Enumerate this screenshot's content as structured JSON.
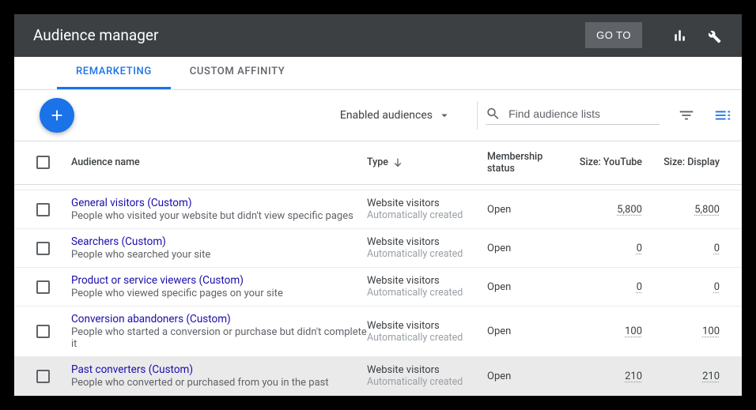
{
  "header": {
    "title": "Audience manager",
    "goto_label": "GO TO"
  },
  "tabs": [
    {
      "label": "REMARKETING",
      "active": true
    },
    {
      "label": "CUSTOM AFFINITY",
      "active": false
    }
  ],
  "toolbar": {
    "dropdown_label": "Enabled audiences",
    "search_placeholder": "Find audience lists"
  },
  "columns": {
    "name": "Audience name",
    "type": "Type",
    "status": "Membership status",
    "youtube": "Size: YouTube",
    "display": "Size: Display"
  },
  "rows": [
    {
      "title": "General visitors (Custom)",
      "desc": "People who visited your website but didn't view specific pages",
      "type_main": "Website visitors",
      "type_sub": "Automatically created",
      "status": "Open",
      "youtube": "5,800",
      "display": "5,800",
      "highlight": false
    },
    {
      "title": "Searchers (Custom)",
      "desc": "People who searched your site",
      "type_main": "Website visitors",
      "type_sub": "Automatically created",
      "status": "Open",
      "youtube": "0",
      "display": "0",
      "highlight": false
    },
    {
      "title": "Product or service viewers (Custom)",
      "desc": "People who viewed specific pages on your site",
      "type_main": "Website visitors",
      "type_sub": "Automatically created",
      "status": "Open",
      "youtube": "0",
      "display": "0",
      "highlight": false
    },
    {
      "title": "Conversion abandoners (Custom)",
      "desc": "People who started a conversion or purchase but didn't complete it",
      "type_main": "Website visitors",
      "type_sub": "Automatically created",
      "status": "Open",
      "youtube": "100",
      "display": "100",
      "highlight": false
    },
    {
      "title": "Past converters (Custom)",
      "desc": "People who converted or purchased from you in the past",
      "type_main": "Website visitors",
      "type_sub": "Automatically created",
      "status": "Open",
      "youtube": "210",
      "display": "210",
      "highlight": true
    }
  ]
}
